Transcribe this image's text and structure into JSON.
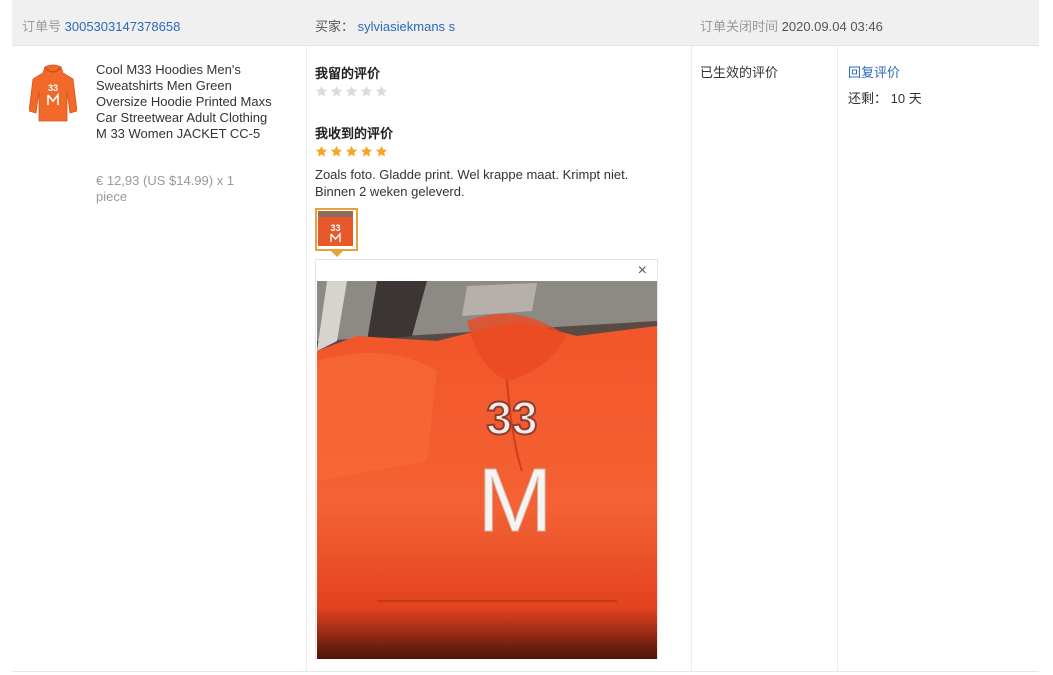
{
  "order": {
    "number_label": "订单号",
    "number_value": "3005303147378658",
    "buyer_label": "买家：",
    "buyer_name": "sylviasiekmans s",
    "closed_label": "订单关闭时间",
    "closed_value": "2020.09.04 03:46"
  },
  "product": {
    "title": "Cool M33 Hoodies Men's Sweatshirts Men Green Oversize Hoodie Printed Maxs Car Streetwear Adult Clothing M 33 Women JACKET CC-5",
    "price": "€ 12,93 (US $14.99) x 1 piece",
    "print_text": "33",
    "image_icon": "orange-hoodie-icon"
  },
  "my_review": {
    "title": "我留的评价",
    "stars": 0,
    "max_stars": 5
  },
  "received_review": {
    "title": "我收到的评价",
    "stars": 5,
    "max_stars": 5,
    "text": "Zoals foto. Gladde print. Wel krappe maat. Krimpt niet. Binnen 2 weken geleverd.",
    "close_symbol": "×",
    "photo_print_number": "33",
    "photo_print_letter": "M"
  },
  "status": {
    "effective_text": "已生效的评价"
  },
  "actions": {
    "reply_label": "回复评价",
    "remaining_label": "还剩：",
    "remaining_value": "10 天"
  },
  "colors": {
    "link": "#2a6ab8",
    "star_filled": "#f5a623",
    "star_empty": "#dcdcdc",
    "thumb_border": "#e8a23a",
    "hoodie": "#f26a2a"
  }
}
